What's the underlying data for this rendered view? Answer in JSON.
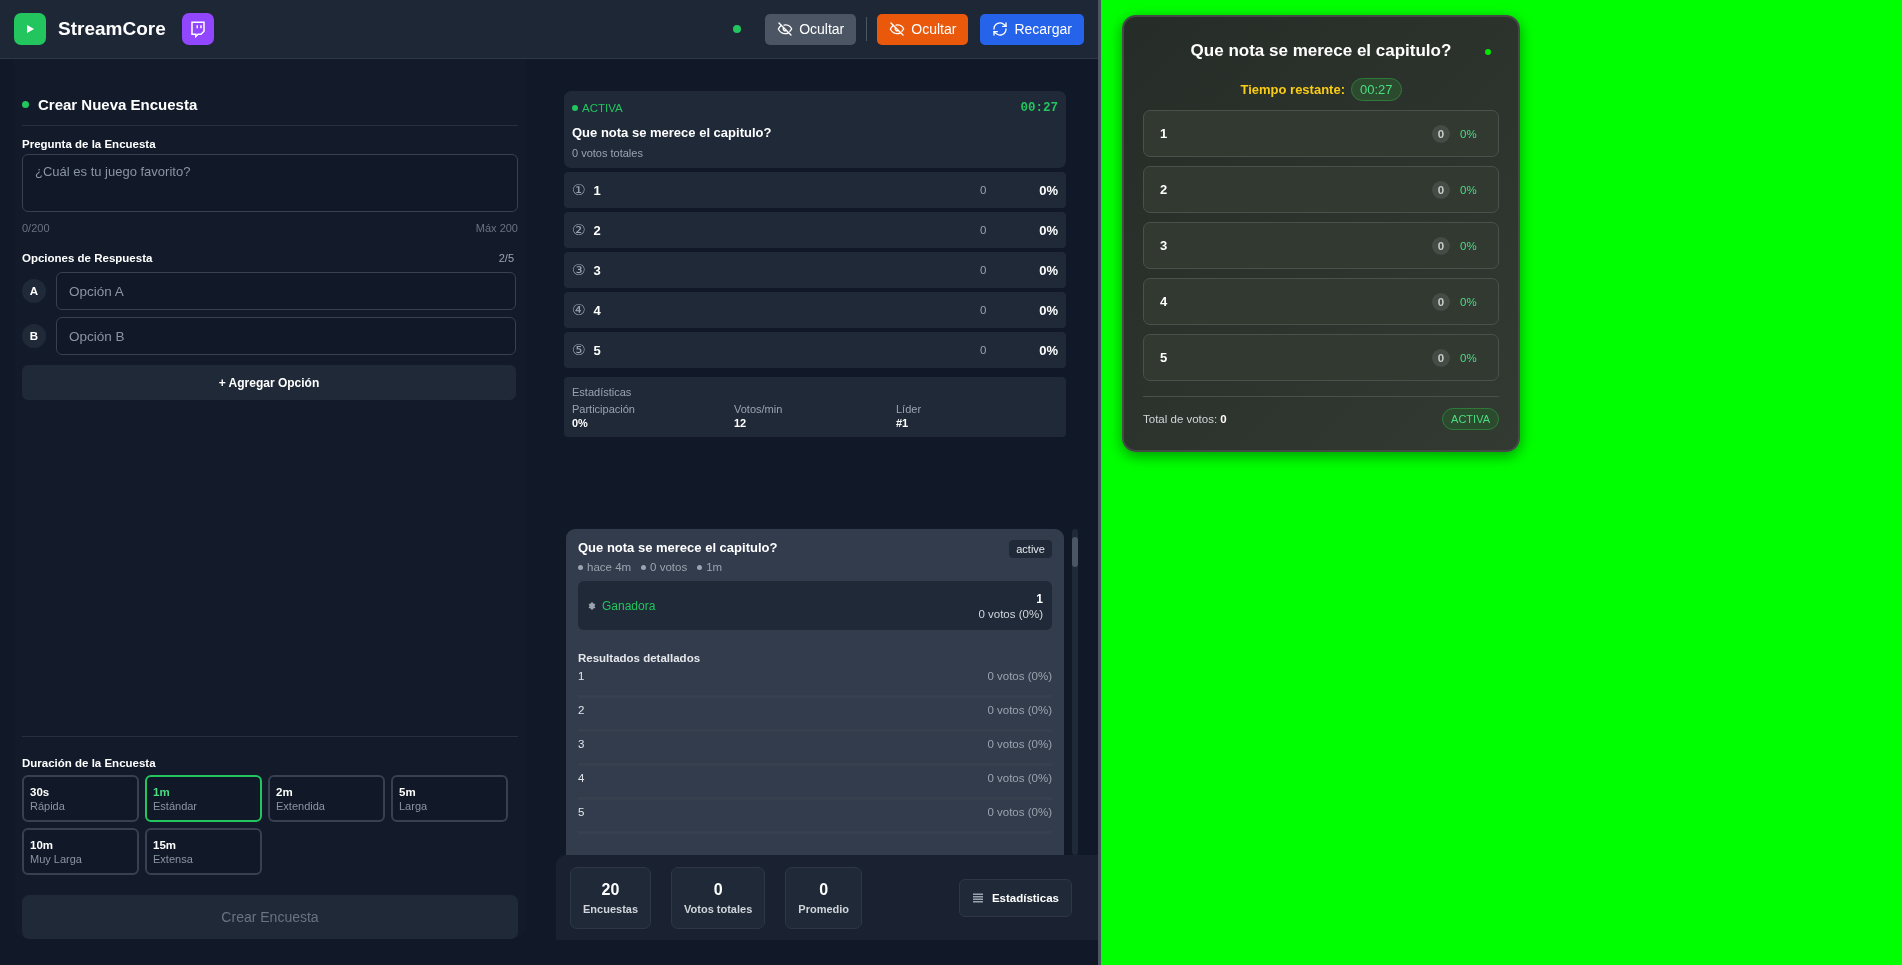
{
  "header": {
    "title": "StreamCore",
    "buttons": [
      {
        "label": "Ocultar",
        "kind": "secondary"
      },
      {
        "label": "Ocultar",
        "kind": "danger"
      },
      {
        "label": "Recargar",
        "kind": "primary"
      }
    ]
  },
  "create": {
    "title": "Crear Nueva Encuesta",
    "question": {
      "label": "Pregunta de la Encuesta",
      "placeholder": "¿Cuál es tu juego favorito?",
      "counter": "0/200",
      "max": "Máx 200"
    },
    "options": {
      "label": "Opciones de Respuesta",
      "count": "2/5",
      "items": [
        {
          "letter": "A",
          "placeholder": "Opción A"
        },
        {
          "letter": "B",
          "placeholder": "Opción B"
        }
      ],
      "add_button": "+ Agregar Opción"
    },
    "duration": {
      "label": "Duración de la Encuesta",
      "options": [
        {
          "value": "30s",
          "caption": "Rápida",
          "selected": false
        },
        {
          "value": "1m",
          "caption": "Estándar",
          "selected": true
        },
        {
          "value": "2m",
          "caption": "Extendida",
          "selected": false
        },
        {
          "value": "5m",
          "caption": "Larga",
          "selected": false
        },
        {
          "value": "10m",
          "caption": "Muy Larga",
          "selected": false
        },
        {
          "value": "15m",
          "caption": "Extensa",
          "selected": false
        }
      ]
    },
    "submit": {
      "label": "Crear Encuesta",
      "disabled": true
    }
  },
  "live_poll": {
    "status": "ACTIVA",
    "timer": "00:27",
    "question": "Que nota se merece el capitulo?",
    "total": "0 votos totales",
    "options": [
      {
        "marker": "①",
        "label": "1",
        "votes": "0",
        "percent": "0%"
      },
      {
        "marker": "②",
        "label": "2",
        "votes": "0",
        "percent": "0%"
      },
      {
        "marker": "③",
        "label": "3",
        "votes": "0",
        "percent": "0%"
      },
      {
        "marker": "④",
        "label": "4",
        "votes": "0",
        "percent": "0%"
      },
      {
        "marker": "⑤",
        "label": "5",
        "votes": "0",
        "percent": "0%"
      }
    ],
    "stats": {
      "title": "Estadísticas",
      "items": [
        {
          "label": "Participación",
          "value": "0%"
        },
        {
          "label": "Votos/min",
          "value": "12"
        },
        {
          "label": "Líder",
          "value": "#1"
        }
      ]
    }
  },
  "history": [
    {
      "question": "Que nota se merece el capitulo?",
      "badge": "active",
      "meta": [
        "hace 4m",
        "0 votos",
        "1m"
      ],
      "winner": {
        "label": "Ganadora",
        "option": "1",
        "votes": "0 votos (0%)"
      },
      "details_title": "Resultados detallados",
      "results": [
        {
          "label": "1",
          "votes": "0 votos (0%)"
        },
        {
          "label": "2",
          "votes": "0 votos (0%)"
        },
        {
          "label": "3",
          "votes": "0 votos (0%)"
        },
        {
          "label": "4",
          "votes": "0 votos (0%)"
        },
        {
          "label": "5",
          "votes": "0 votos (0%)"
        }
      ]
    }
  ],
  "summary": {
    "stats": [
      {
        "value": "20",
        "label": "Encuestas"
      },
      {
        "value": "0",
        "label": "Votos totales"
      },
      {
        "value": "0",
        "label": "Promedio"
      }
    ],
    "button": "Estadísticas"
  },
  "overlay": {
    "question": "Que nota se merece el capitulo?",
    "time_label": "Tiempo restante:",
    "timer": "00:27",
    "options": [
      {
        "label": "1",
        "votes": "0",
        "percent": "0%"
      },
      {
        "label": "2",
        "votes": "0",
        "percent": "0%"
      },
      {
        "label": "3",
        "votes": "0",
        "percent": "0%"
      },
      {
        "label": "4",
        "votes": "0",
        "percent": "0%"
      },
      {
        "label": "5",
        "votes": "0",
        "percent": "0%"
      }
    ],
    "total": "Total de votos: **0**",
    "status": "ACTIVA"
  }
}
